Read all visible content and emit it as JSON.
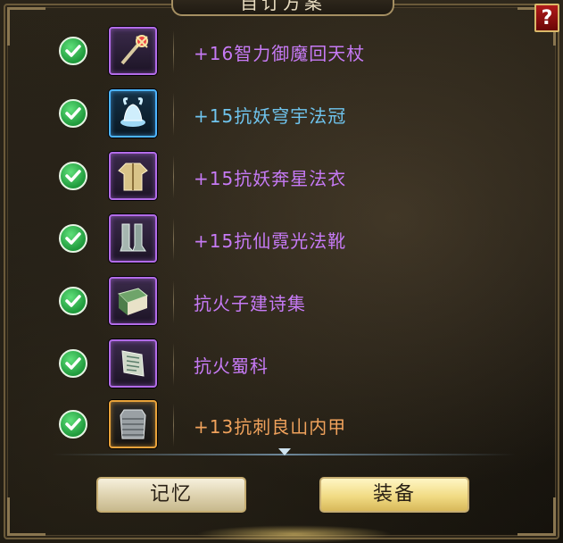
{
  "title": "自订方案",
  "help_label": "?",
  "items": [
    {
      "name": "+16智力御魔回天杖",
      "icon": "staff-icon",
      "tier": "purple"
    },
    {
      "name": "+15抗妖穹宇法冠",
      "icon": "crown-icon",
      "tier": "blue"
    },
    {
      "name": "+15抗妖奔星法衣",
      "icon": "robe-icon",
      "tier": "purple"
    },
    {
      "name": "+15抗仙霓光法靴",
      "icon": "boots-icon",
      "tier": "purple"
    },
    {
      "name": "抗火子建诗集",
      "icon": "book-icon",
      "tier": "purple"
    },
    {
      "name": "抗火蜀科",
      "icon": "scroll-icon",
      "tier": "purple"
    },
    {
      "name": "+13抗刺良山内甲",
      "icon": "armor-icon",
      "tier": "orange"
    }
  ],
  "buttons": {
    "memory": "记忆",
    "equip": "装备"
  },
  "colors": {
    "purple": "#c67af5",
    "blue": "#6fc4ee",
    "orange": "#f0a25c",
    "check": "#2fb34f"
  }
}
